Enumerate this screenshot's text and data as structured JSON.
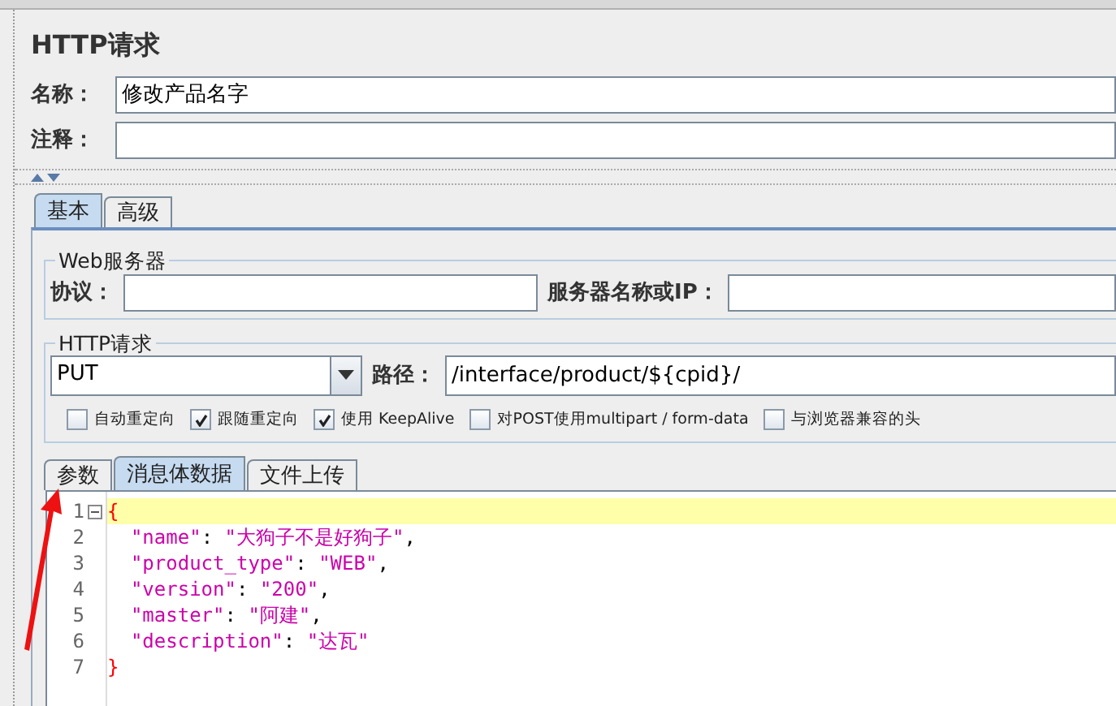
{
  "title": "HTTP请求",
  "name_field": {
    "label": "名称：",
    "value": "修改产品名字"
  },
  "comment_field": {
    "label": "注释："
  },
  "tabs": [
    {
      "label": "基本",
      "selected": true
    },
    {
      "label": "高级",
      "selected": false
    }
  ],
  "web_server": {
    "title": "Web服务器",
    "protocol_label": "协议：",
    "server_label": "服务器名称或IP："
  },
  "http_request": {
    "title": "HTTP请求",
    "method": "PUT",
    "path_label": "路径：",
    "path": "/interface/product/${cpid}/"
  },
  "options": [
    {
      "label": "自动重定向",
      "checked": false
    },
    {
      "label": "跟随重定向",
      "checked": true
    },
    {
      "label": "使用 KeepAlive",
      "checked": true
    },
    {
      "label": "对POST使用multipart / form-data",
      "checked": false
    },
    {
      "label": "与浏览器兼容的头",
      "checked": false
    }
  ],
  "sub_tabs": [
    {
      "label": "参数",
      "selected": false
    },
    {
      "label": "消息体数据",
      "selected": true
    },
    {
      "label": "文件上传",
      "selected": false
    }
  ],
  "editor": {
    "lines": [
      {
        "number": "1",
        "text": "{",
        "current": true
      },
      {
        "number": "2",
        "text": "  \"name\": \"大狗子不是好狗子\",",
        "current": false
      },
      {
        "number": "3",
        "text": "  \"product_type\": \"WEB\",",
        "current": false
      },
      {
        "number": "4",
        "text": "  \"version\": \"200\",",
        "current": false
      },
      {
        "number": "5",
        "text": "  \"master\": \"阿建\",",
        "current": false
      },
      {
        "number": "6",
        "text": "  \"description\": \"达瓦\"",
        "current": false
      },
      {
        "number": "7",
        "text": "}",
        "current": false
      }
    ]
  }
}
